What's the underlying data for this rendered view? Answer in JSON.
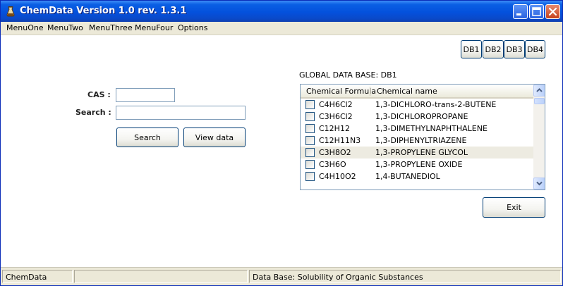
{
  "window": {
    "title": "ChemData Version 1.0 rev. 1.3.1",
    "controls": {
      "minimize": "minimize",
      "maximize": "maximize",
      "close": "close"
    }
  },
  "menu": [
    "MenuOne",
    "MenuTwo",
    "MenuThree",
    "MenuFour",
    "Options"
  ],
  "db_buttons": [
    "DB1",
    "DB2",
    "DB3",
    "DB4"
  ],
  "search_form": {
    "cas_label": "CAS :",
    "cas_value": "",
    "search_label": "Search :",
    "search_value": "",
    "search_button": "Search",
    "view_button": "View data"
  },
  "database_heading": "GLOBAL DATA BASE: DB1",
  "list": {
    "columns": [
      "Chemical Formula",
      "Chemical name"
    ],
    "rows": [
      {
        "formula": "C4H6Cl2",
        "name": "1,3-DICHLORO-trans-2-BUTENE",
        "checked": false
      },
      {
        "formula": "C3H6Cl2",
        "name": "1,3-DICHLOROPROPANE",
        "checked": false
      },
      {
        "formula": "C12H12",
        "name": "1,3-DIMETHYLNAPHTHALENE",
        "checked": false
      },
      {
        "formula": "C12H11N3",
        "name": "1,3-DIPHENYLTRIAZENE",
        "checked": false
      },
      {
        "formula": "C3H8O2",
        "name": "1,3-PROPYLENE GLYCOL",
        "checked": false,
        "highlighted": true
      },
      {
        "formula": "C3H6O",
        "name": "1,3-PROPYLENE OXIDE",
        "checked": false
      },
      {
        "formula": "C4H10O2",
        "name": "1,4-BUTANEDIOL",
        "checked": false
      }
    ]
  },
  "exit_button": "Exit",
  "status": {
    "left": "ChemData",
    "right": "Data Base: Solubility of Organic Substances"
  },
  "colors": {
    "titlebar": "#0451dc",
    "frame": "#ece9d8",
    "selected_row": "#edebe1",
    "button_border": "#003c74"
  }
}
